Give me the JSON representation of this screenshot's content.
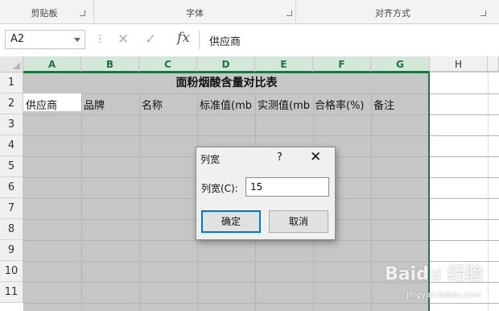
{
  "ribbon": {
    "groups": [
      "剪贴板",
      "字体",
      "对齐方式"
    ]
  },
  "formula_bar": {
    "name_box": "A2",
    "formula": "供应商",
    "fx_label": "fx"
  },
  "sheet": {
    "columns": [
      "A",
      "B",
      "C",
      "D",
      "E",
      "F",
      "G",
      "H"
    ],
    "rows": [
      "1",
      "2",
      "3",
      "4",
      "5",
      "6",
      "7",
      "8",
      "9",
      "10",
      "11"
    ],
    "title": "面粉烟酸含量对比表",
    "headers": [
      "供应商",
      "品牌",
      "名称",
      "标准值(mb",
      "实测值(mb",
      "合格率(%)",
      "备注"
    ]
  },
  "dialog": {
    "title": "列宽",
    "help": "?",
    "close": "✕",
    "field_label": "列宽(C):",
    "value": "15",
    "ok_label": "确定",
    "cancel_label": "取消"
  },
  "watermark": {
    "text": "Baidu 经验",
    "url": "jingyan.baidu.com"
  },
  "colors": {
    "selection_green": "#217346",
    "selected_fill": "#c6c6c6",
    "dialog_focus": "#0078d7"
  }
}
